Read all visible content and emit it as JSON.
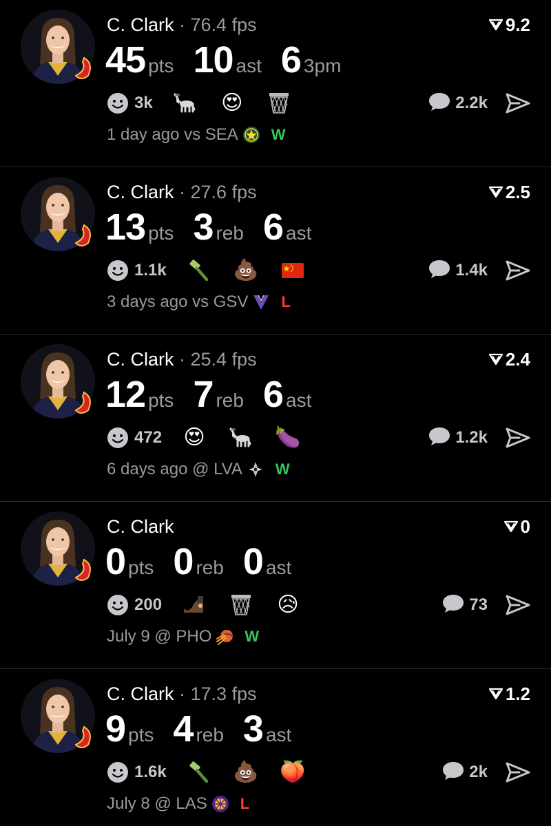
{
  "colors": {
    "win": "#34c759",
    "loss": "#ff3b30",
    "muted": "#9a9a9f",
    "bg": "#000000"
  },
  "posts": [
    {
      "player": "C. Clark",
      "fps": "· 76.4 fps",
      "score": "9.2",
      "stats": [
        {
          "num": "45",
          "unit": "pts"
        },
        {
          "num": "10",
          "unit": "ast"
        },
        {
          "num": "6",
          "unit": "3pm"
        }
      ],
      "reaction_count": "3k",
      "emojis": [
        "goat",
        "😍",
        "basketball-hoop"
      ],
      "comments": "2.2k",
      "when": "1 day ago vs SEA",
      "opponent_logo": "seattle-storm-logo",
      "result": "W",
      "result_type": "w"
    },
    {
      "player": "C. Clark",
      "fps": "· 27.6 fps",
      "score": "2.5",
      "stats": [
        {
          "num": "13",
          "unit": "pts"
        },
        {
          "num": "3",
          "unit": "reb"
        },
        {
          "num": "6",
          "unit": "ast"
        }
      ],
      "reaction_count": "1.1k",
      "emojis": [
        "hammer",
        "💩",
        "china-flag"
      ],
      "comments": "1.4k",
      "when": "3 days ago vs GSV",
      "opponent_logo": "golden-state-valkyries-logo",
      "result": "L",
      "result_type": "l"
    },
    {
      "player": "C. Clark",
      "fps": "· 25.4 fps",
      "score": "2.4",
      "stats": [
        {
          "num": "12",
          "unit": "pts"
        },
        {
          "num": "7",
          "unit": "reb"
        },
        {
          "num": "6",
          "unit": "ast"
        }
      ],
      "reaction_count": "472",
      "emojis": [
        "😍",
        "goat",
        "🍆"
      ],
      "comments": "1.2k",
      "when": "6 days ago @ LVA",
      "opponent_logo": "las-vegas-aces-logo",
      "result": "W",
      "result_type": "w"
    },
    {
      "player": "C. Clark",
      "fps": "",
      "score": "0",
      "stats": [
        {
          "num": "0",
          "unit": "pts"
        },
        {
          "num": "0",
          "unit": "reb"
        },
        {
          "num": "0",
          "unit": "ast"
        }
      ],
      "reaction_count": "200",
      "emojis": [
        "bench",
        "basketball-hoop",
        "😥"
      ],
      "comments": "73",
      "when": "July 9 @ PHO",
      "opponent_logo": "phoenix-mercury-logo",
      "result": "W",
      "result_type": "w"
    },
    {
      "player": "C. Clark",
      "fps": "· 17.3 fps",
      "score": "1.2",
      "stats": [
        {
          "num": "9",
          "unit": "pts"
        },
        {
          "num": "4",
          "unit": "reb"
        },
        {
          "num": "3",
          "unit": "ast"
        }
      ],
      "reaction_count": "1.6k",
      "emojis": [
        "hammer",
        "💩",
        "🍑"
      ],
      "comments": "2k",
      "when": "July 8 @ LAS",
      "opponent_logo": "la-sparks-logo",
      "result": "L",
      "result_type": "l"
    }
  ]
}
